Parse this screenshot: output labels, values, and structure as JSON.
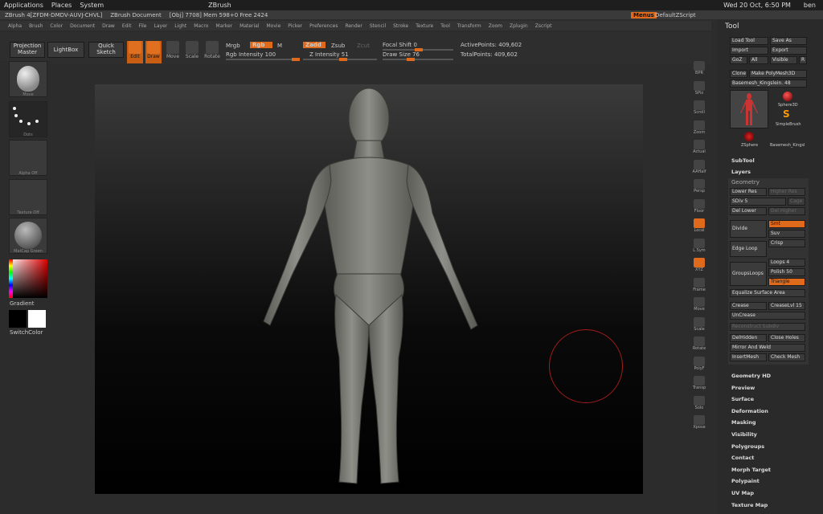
{
  "sys": {
    "apps": "Applications",
    "places": "Places",
    "system": "System",
    "window": "ZBrush",
    "clock": "Wed 20 Oct, 6:50 PM",
    "user": "ben"
  },
  "title": {
    "app": "ZBrush 4[ZFDM-DMDV-AUVJ-CHVL]",
    "doc": "ZBrush Document",
    "stats": "[Obj] 7708] Mem 598+0 Free 2424",
    "menus": "Menus",
    "script": "DefaultZScript"
  },
  "menu": [
    "Alpha",
    "Brush",
    "Color",
    "Document",
    "Draw",
    "Edit",
    "File",
    "Layer",
    "Light",
    "Macro",
    "Marker",
    "Material",
    "Movie",
    "Picker",
    "Preferences",
    "Render",
    "Stencil",
    "Stroke",
    "Texture",
    "Tool",
    "Transform",
    "Zoom",
    "Zplugin",
    "Zscript"
  ],
  "shelf": {
    "projection": "Projection Master",
    "lightbox": "LightBox",
    "quicksketch": "Quick Sketch",
    "edit": "Edit",
    "draw": "Draw",
    "move": "Move",
    "scale": "Scale",
    "rotate": "Rotate",
    "mrgb": "Mrgb",
    "rgb": "Rgb",
    "m": "M",
    "rgb_int": "Rgb Intensity 100",
    "zadd": "Zadd",
    "zsub": "Zsub",
    "zcut": "Zcut",
    "z_int": "Z Intensity 51",
    "focal": "Focal Shift 0",
    "draw_size": "Draw Size 76",
    "active": "ActivePoints: 409,602",
    "total": "TotalPoints: 409,602"
  },
  "left": {
    "move": "Move",
    "dots": "Dots",
    "alpha": "Alpha Off",
    "texture": "Texture Off",
    "matcap": "MatCap Green",
    "gradient": "Gradient",
    "switch": "SwitchColor"
  },
  "right": [
    "BPR",
    "SPix",
    "Scroll",
    "Zoom",
    "Actual",
    "AAHalf",
    "Persp",
    "Floor",
    "Local",
    "L.Sym",
    "XYZ",
    "Frame",
    "Move",
    "Scale",
    "Rotate",
    "PolyF",
    "Transp",
    "Solo",
    "Xpose"
  ],
  "tool": {
    "title": "Tool",
    "load": "Load Tool",
    "save": "Save As",
    "import": "Import",
    "export": "Export",
    "goz": "GoZ",
    "all": "All",
    "visible": "Visible",
    "r": "R",
    "clone": "Clone",
    "makepoly": "Make PolyMesh3D",
    "mesh": "Basemesh_Kingslein. 48",
    "r2": "R",
    "sphere3d": "Sphere3D",
    "simplebrush": "SimpleBrush",
    "zsphere": "ZSphere",
    "basemesh": "Basemesh_Kingsl",
    "subtool": "SubTool",
    "layers": "Layers",
    "geometry": "Geometry",
    "lower": "Lower Res",
    "higher": "Higher Res",
    "sdiv": "SDiv 5",
    "cage": "Cage",
    "dellower": "Del Lower",
    "delhigher": "Del Higher",
    "divide": "Divide",
    "smt": "Smt",
    "suv": "Suv",
    "crisp": "Crisp",
    "edge": "Edge Loop",
    "loops": "Loops 4",
    "polish": "Polish 50",
    "groups": "GroupsLoops",
    "triangle": "Triangle",
    "equalize": "Equalize Surface Area",
    "crease": "Crease",
    "creaselvl": "CreaseLvl 15",
    "uncrease": "UnCrease",
    "recon": "Reconstruct Subdiv",
    "delhidden": "DelHidden",
    "closeholes": "Close Holes",
    "mirror": "Mirror And Weld",
    "insert": "InsertMesh",
    "check": "Check Mesh",
    "sections": [
      "Geometry HD",
      "Preview",
      "Surface",
      "Deformation",
      "Masking",
      "Visibility",
      "Polygroups",
      "Contact",
      "Morph Target",
      "Polypaint",
      "UV Map",
      "Texture Map"
    ]
  }
}
